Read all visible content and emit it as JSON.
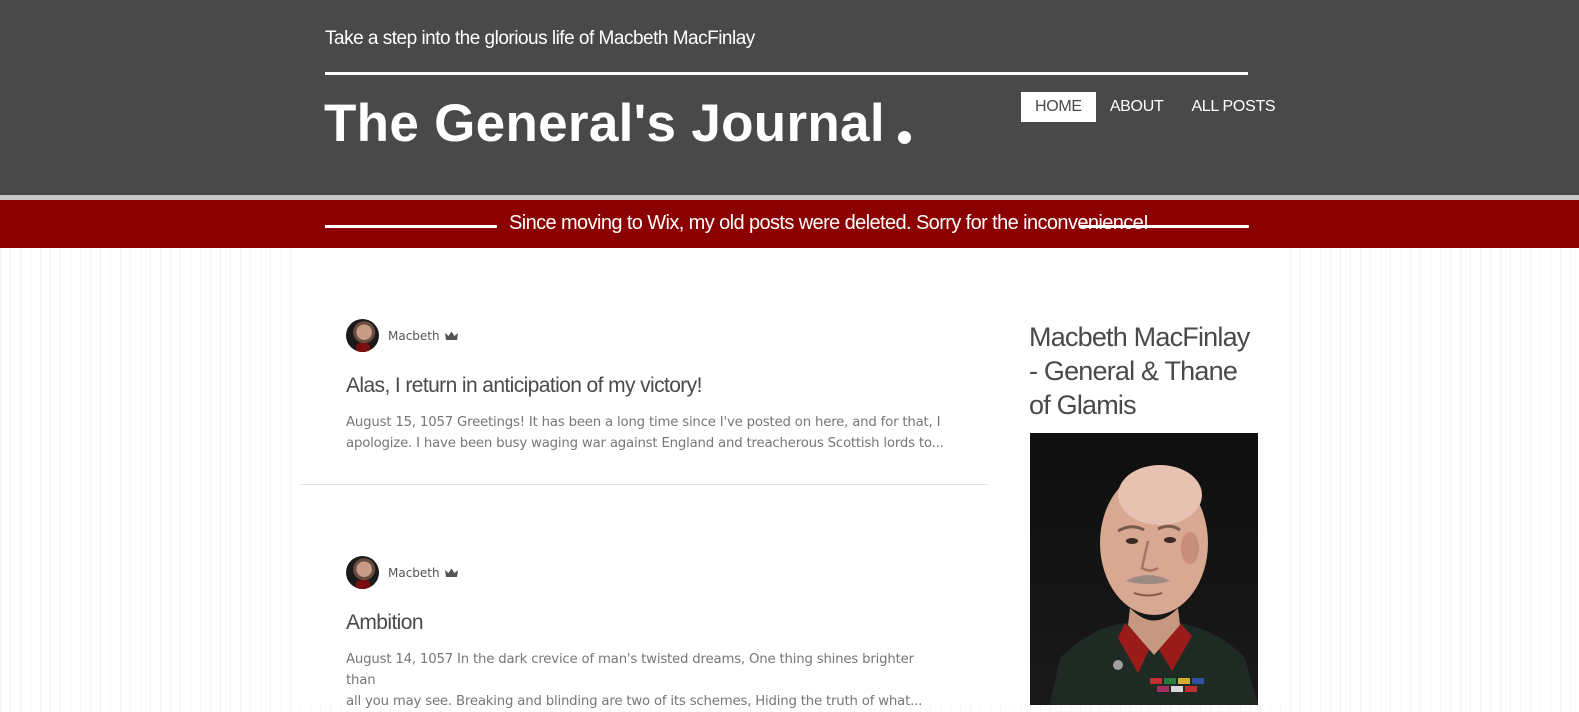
{
  "header": {
    "tagline": "Take a step into the glorious life of Macbeth MacFinlay",
    "site_title": "The General's Journal",
    "nav": [
      {
        "label": "HOME",
        "active": true
      },
      {
        "label": "ABOUT",
        "active": false
      },
      {
        "label": "ALL POSTS",
        "active": false
      }
    ]
  },
  "banner": {
    "text": "Since moving to Wix, my old posts were deleted. Sorry for the inconvenience!"
  },
  "posts": [
    {
      "author": "Macbeth",
      "title": "Alas, I return in anticipation of my victory!",
      "excerpt_line1": "August 15, 1057 Greetings! It has been a long time since I've posted on here, and for that, I",
      "excerpt_line2": "apologize. I have been busy waging war against England and treacherous Scottish lords to..."
    },
    {
      "author": "Macbeth",
      "title": "Ambition",
      "excerpt_line1": "August 14, 1057 In the dark crevice of man's twisted dreams, One thing shines brighter than",
      "excerpt_line2": "all you may see. Breaking and blinding are two of its schemes, Hiding the truth of what..."
    }
  ],
  "sidebar": {
    "title": "Macbeth MacFinlay - General & Thane of Glamis"
  },
  "colors": {
    "header_bg": "#494949",
    "banner_bg": "#8b0000",
    "text_dark": "#4a4a4a"
  }
}
